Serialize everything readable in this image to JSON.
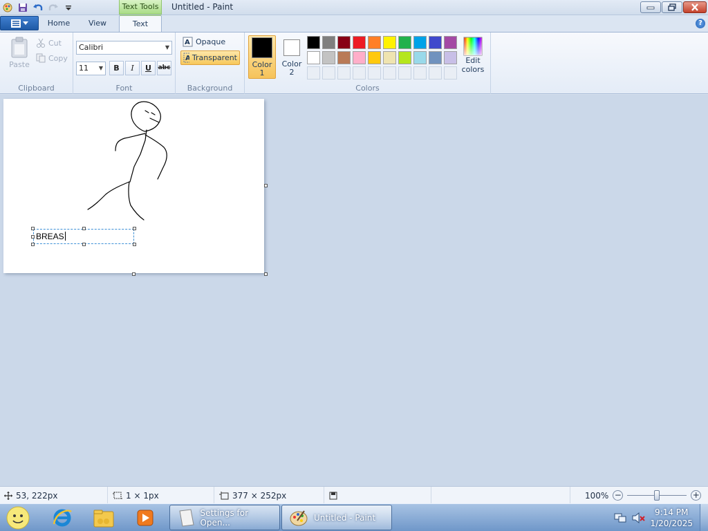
{
  "window": {
    "title": "Untitled - Paint",
    "context_tab": "Text Tools"
  },
  "tabs": [
    {
      "label": "Home"
    },
    {
      "label": "View"
    },
    {
      "label": "Text"
    }
  ],
  "clipboard": {
    "paste": "Paste",
    "cut": "Cut",
    "copy": "Copy",
    "label": "Clipboard"
  },
  "font": {
    "family": "Calibri",
    "size": "11",
    "bold": "B",
    "italic": "I",
    "underline": "U",
    "strike": "abc",
    "label": "Font"
  },
  "background": {
    "opaque": "Opaque",
    "transparent": "Transparent",
    "label": "Background"
  },
  "colors": {
    "color1_label": "Color",
    "color1_num": "1",
    "color2_label": "Color",
    "color2_num": "2",
    "color1_value": "#000000",
    "color2_value": "#ffffff",
    "edit_label": "Edit",
    "edit_label2": "colors",
    "label": "Colors",
    "palette_row1": [
      "#000000",
      "#7f7f7f",
      "#880015",
      "#ed1c24",
      "#ff7f27",
      "#fff200",
      "#22b14c",
      "#00a2e8",
      "#3f48cc",
      "#a349a4"
    ],
    "palette_row2": [
      "#ffffff",
      "#c3c3c3",
      "#b97a57",
      "#ffaec9",
      "#ffc90e",
      "#efe4b0",
      "#b5e61d",
      "#99d9ea",
      "#7092be",
      "#c8bfe7"
    ]
  },
  "canvas": {
    "text_content": "BREAS"
  },
  "status": {
    "cursor_pos": "53, 222px",
    "selection_size": "1 × 1px",
    "image_size": "377 × 252px",
    "zoom": "100%"
  },
  "taskbar": {
    "task1": "Settings for Open...",
    "task2": "Untitled - Paint",
    "time": "9:14 PM",
    "date": "1/20/2025"
  }
}
